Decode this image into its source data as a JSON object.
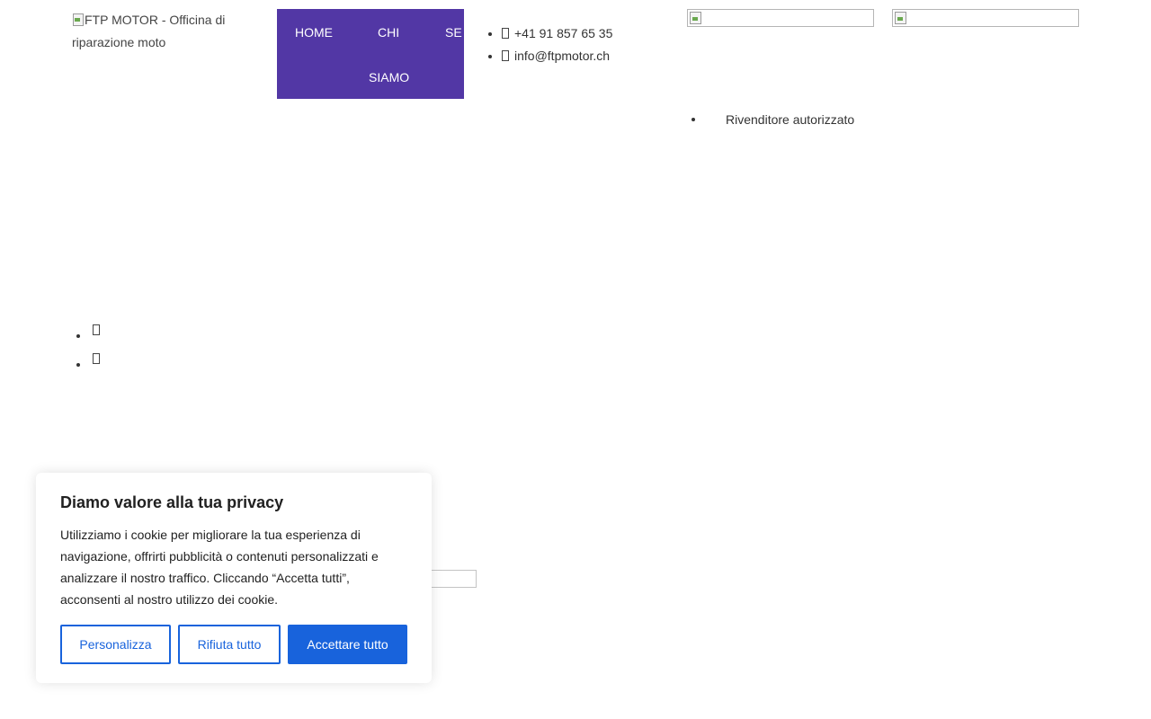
{
  "header": {
    "logo_alt": "FTP MOTOR - Officina di riparazione moto"
  },
  "nav": {
    "items": [
      {
        "label": "HOME"
      },
      {
        "label": "CHI"
      },
      {
        "label": "SIAMO"
      },
      {
        "label": "SE"
      }
    ],
    "background": "#5237a5",
    "text_color": "#ffffff"
  },
  "contact": {
    "phone": "+41 91 857 65 35",
    "email": "info@ftpmotor.ch",
    "phone_icon": "phone-icon",
    "email_icon": "envelope-icon"
  },
  "dealer": {
    "label": "Rivenditore autorizzato"
  },
  "social": {
    "icons": [
      "social-icon",
      "social-icon"
    ]
  },
  "cookie_banner": {
    "title": "Diamo valore alla tua privacy",
    "text": "Utilizziamo i cookie per migliorare la tua esperienza di navigazione, offrirti pubblicità o contenuti personalizzati e analizzare il nostro traffico. Cliccando “Accetta tutti”, acconsenti al nostro utilizzo dei cookie.",
    "buttons": {
      "customize": "Personalizza",
      "reject": "Rifiuta tutto",
      "accept": "Accettare tutto"
    },
    "accent_color": "#1863dc"
  }
}
